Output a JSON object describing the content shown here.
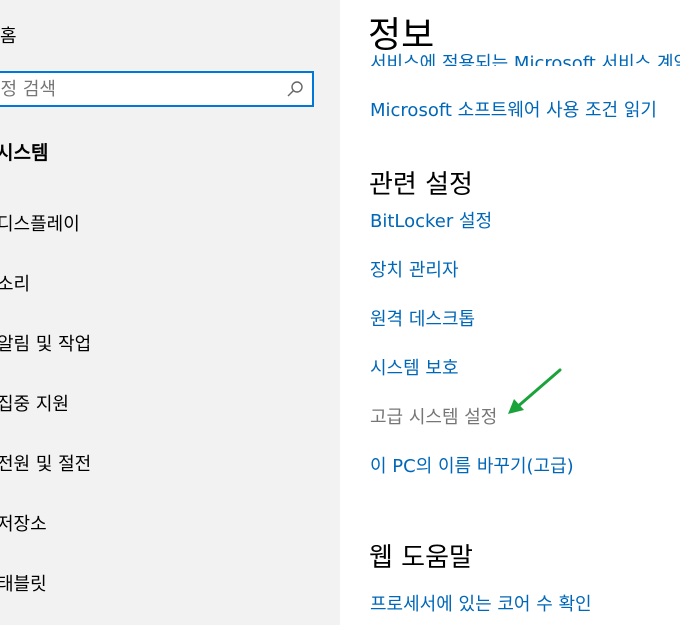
{
  "nav": {
    "home_label": "홈",
    "search_placeholder": "설정 검색",
    "section_label": "시스템",
    "items": [
      {
        "label": "디스플레이"
      },
      {
        "label": "소리"
      },
      {
        "label": "알림 및 작업"
      },
      {
        "label": "집중 지원"
      },
      {
        "label": "전원 및 절전"
      },
      {
        "label": "저장소"
      },
      {
        "label": "태블릿"
      }
    ]
  },
  "content": {
    "title": "정보",
    "clipped_link": "서비스에 적용되는 Microsoft 서비스 계약 읽기",
    "license_link": "Microsoft 소프트웨어 사용 조건 읽기",
    "related": {
      "heading": "관련 설정",
      "links": [
        {
          "label": "BitLocker 설정"
        },
        {
          "label": "장치 관리자"
        },
        {
          "label": "원격 데스크톱"
        },
        {
          "label": "시스템 보호"
        },
        {
          "label": "고급 시스템 설정"
        },
        {
          "label": "이 PC의 이름 바꾸기(고급)"
        }
      ]
    },
    "web_help": {
      "heading": "웹 도움말",
      "links": [
        {
          "label": "프로세서에 있는 코어 수 확인"
        }
      ]
    }
  },
  "colors": {
    "accent": "#0078d7",
    "link": "#0067b8",
    "disabled_link": "#767676",
    "nav_background": "#f2f2f2",
    "annotation_arrow": "#1aa33a"
  }
}
